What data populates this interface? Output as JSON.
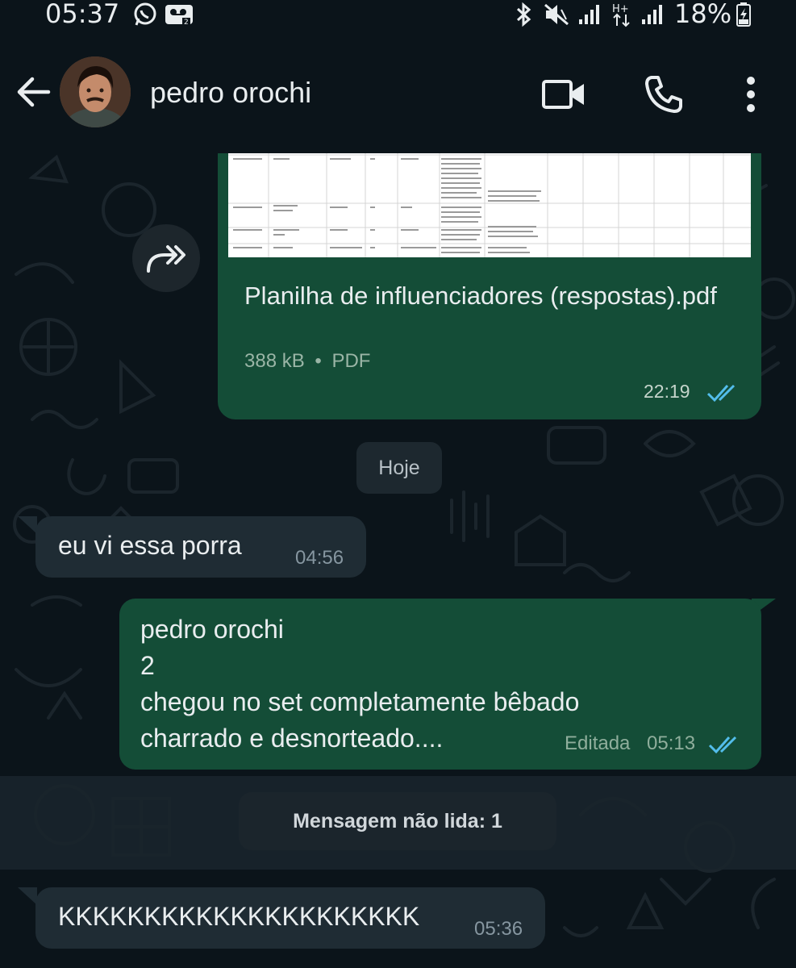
{
  "status_bar": {
    "time": "05:37",
    "battery": "18%",
    "icons": [
      "whatsapp-icon",
      "voicemail-icon",
      "bluetooth-icon",
      "mute-icon",
      "signal-icon",
      "data-icon",
      "signal-icon",
      "battery-icon"
    ]
  },
  "header": {
    "contact_name": "pedro orochi",
    "icons": [
      "back-arrow-icon",
      "video-call-icon",
      "phone-call-icon",
      "more-options-icon"
    ]
  },
  "messages": {
    "document": {
      "title": "Planilha de influenciadores (respostas).pdf",
      "size": "388 kB",
      "separator": "•",
      "type": "PDF",
      "time": "22:19",
      "status": "read"
    },
    "date_chip": "Hoje",
    "incoming_1": {
      "text": "eu vi essa porra",
      "time": "04:56"
    },
    "outgoing_1": {
      "line1": "pedro orochi",
      "line2": "2",
      "line3": "chegou no set completamente bêbado",
      "line4": "charrado e desnorteado....",
      "edited_label": "Editada",
      "time": "05:13",
      "status": "read"
    },
    "unread_banner": "Mensagem não lida: 1",
    "incoming_2": {
      "text": "KKKKKKKKKKKKKKKKKKKKK",
      "time": "05:36"
    }
  },
  "colors": {
    "background": "#0b141a",
    "incoming_bubble": "#1f2c34",
    "outgoing_bubble": "#144d37",
    "read_ticks": "#53bdeb"
  }
}
